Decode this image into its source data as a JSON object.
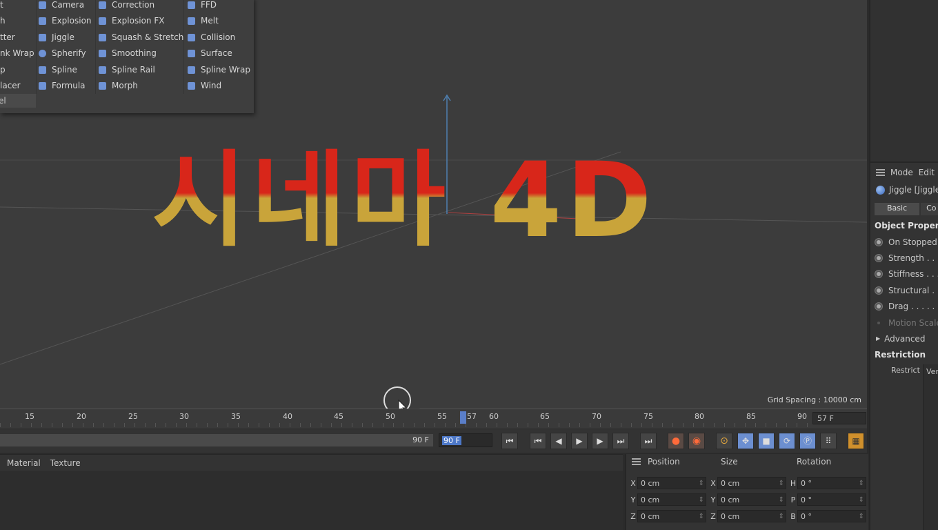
{
  "deformer_menu": {
    "col1": [
      "t",
      "h",
      "tter",
      "nk Wrap",
      "p",
      "lacer",
      "el"
    ],
    "col2": [
      "Camera",
      "Explosion",
      "Jiggle",
      "Spherify",
      "Spline",
      "Formula"
    ],
    "col3": [
      "Correction",
      "Explosion FX",
      "Squash & Stretch",
      "Smoothing",
      "Spline Rail",
      "Morph"
    ],
    "col4": [
      "FFD",
      "Melt",
      "Collision",
      "Surface",
      "Spline Wrap",
      "Wind"
    ]
  },
  "viewport": {
    "text_3d": "시네마 4D",
    "grid_spacing": "Grid Spacing : 10000 cm"
  },
  "attributes": {
    "menu": [
      "Mode",
      "Edit"
    ],
    "object_title": "Jiggle [Jiggle",
    "tabs": [
      "Basic",
      "Co"
    ],
    "section": "Object Properties",
    "props": [
      "On Stopped",
      "Strength . . .",
      "Stiffness . . .",
      "Structural . .",
      "Drag . . . . .",
      "Motion Scale"
    ],
    "advanced": "Advanced",
    "restriction": "Restriction",
    "restrict_label": "Restrict",
    "restrict_value": "Vert"
  },
  "timeline": {
    "labels": [
      "15",
      "20",
      "25",
      "30",
      "35",
      "40",
      "45",
      "50",
      "55",
      "57",
      "60",
      "65",
      "70",
      "75",
      "80",
      "85",
      "90"
    ],
    "current_frame_field": "57 F",
    "range_end": "90 F",
    "end_frame": "90 F"
  },
  "material_manager": {
    "tabs": [
      "Material",
      "Texture"
    ]
  },
  "coordinates": {
    "headers": [
      "Position",
      "Size",
      "Rotation"
    ],
    "rows": [
      {
        "p_label": "X",
        "p": "0 cm",
        "s_label": "X",
        "s": "0 cm",
        "r_label": "H",
        "r": "0 °"
      },
      {
        "p_label": "Y",
        "p": "0 cm",
        "s_label": "Y",
        "s": "0 cm",
        "r_label": "P",
        "r": "0 °"
      },
      {
        "p_label": "Z",
        "p": "0 cm",
        "s_label": "Z",
        "s": "0 cm",
        "r_label": "B",
        "r": "0 °"
      }
    ]
  }
}
